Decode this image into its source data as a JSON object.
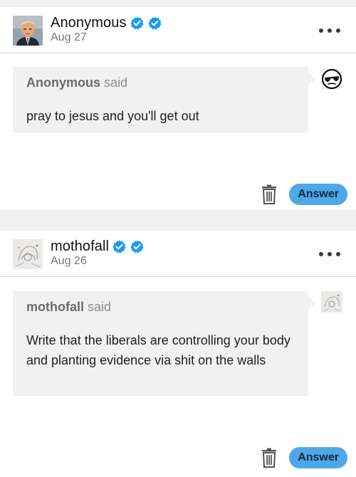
{
  "posts": [
    {
      "blog_name": "Anonymous",
      "date": "Aug 27",
      "avatar_icon": "mugshot-avatar",
      "verified_badges": [
        "verified-badge-icon",
        "verified-badge-icon"
      ],
      "asker": "Anonymous",
      "said_label": "said",
      "question": "pray to jesus and you'll get out",
      "asker_avatar_icon": "anonymous-sunglasses-icon",
      "answer_label": "Answer"
    },
    {
      "blog_name": "mothofall",
      "date": "Aug 26",
      "avatar_icon": "sketch-avatar",
      "verified_badges": [
        "verified-badge-icon",
        "verified-badge-icon"
      ],
      "asker": "mothofall",
      "said_label": "said",
      "question": "Write that the liberals are controlling your body and planting evidence via shit on the walls",
      "asker_avatar_icon": "sketch-avatar",
      "answer_label": "Answer"
    }
  ],
  "colors": {
    "page_background": "#f0f0f0",
    "card_background": "#ffffff",
    "bubble_background": "#f1f1f1",
    "verified_blue": "#1d9bf0",
    "answer_button": "#4ea8e8"
  }
}
